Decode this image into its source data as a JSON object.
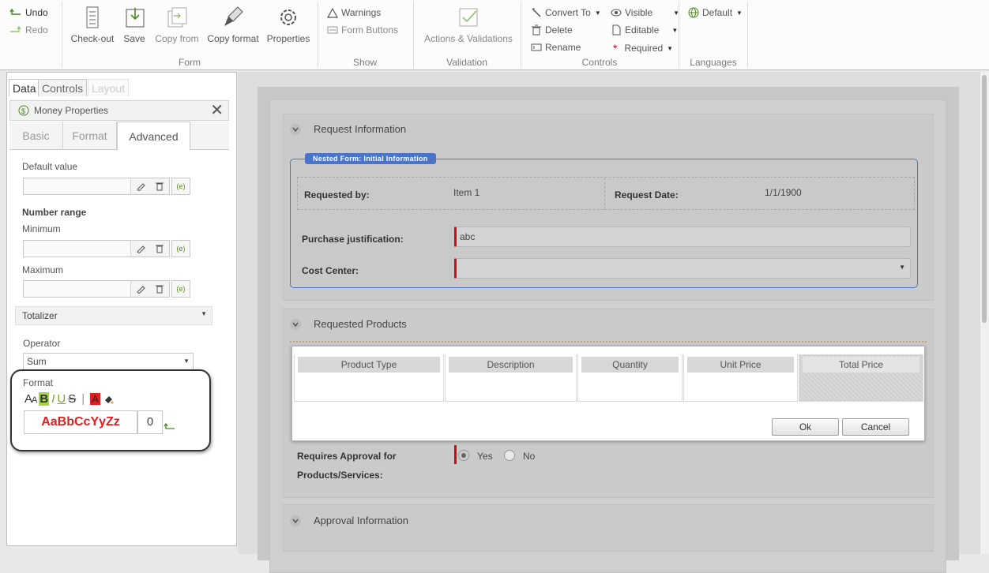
{
  "ribbon": {
    "undo": "Undo",
    "redo": "Redo",
    "form_group": {
      "label": "Form",
      "checkout": "Check-out",
      "save": "Save",
      "copy_from": "Copy from",
      "copy_format": "Copy format",
      "properties": "Properties"
    },
    "show_group": {
      "label": "Show",
      "warnings": "Warnings",
      "form_buttons": "Form Buttons"
    },
    "validation_group": {
      "label": "Validation",
      "actions": "Actions & Validations"
    },
    "controls_group": {
      "label": "Controls",
      "convert_to": "Convert To",
      "delete": "Delete",
      "rename": "Rename",
      "visible": "Visible",
      "editable": "Editable",
      "required": "Required"
    },
    "languages_group": {
      "label": "Languages",
      "default": "Default"
    }
  },
  "left_panel": {
    "tabs": [
      "Data",
      "Controls",
      "Layout"
    ],
    "header_title": "Money Properties",
    "sub_tabs": [
      "Basic",
      "Format",
      "Advanced"
    ],
    "default_value_label": "Default value",
    "number_range_label": "Number range",
    "minimum_label": "Minimum",
    "maximum_label": "Maximum",
    "expr_label": "(e)",
    "totalizer_label": "Totalizer",
    "operator_label": "Operator",
    "operator_value": "Sum",
    "format_label": "Format",
    "format_preview": "AaBbCcYyZz",
    "format_decimals": "0"
  },
  "form": {
    "section1_title": "Request Information",
    "nested_tag": "Nested Form: Initial Information",
    "requested_by_label": "Requested by:",
    "requested_by_value": "Item 1",
    "request_date_label": "Request Date:",
    "request_date_value": "1/1/1900",
    "purchase_label": "Purchase justification:",
    "purchase_value": "abc",
    "cost_center_label": "Cost Center:",
    "section2_title": "Requested Products",
    "columns": [
      "Product Type",
      "Description",
      "Quantity",
      "Unit Price",
      "Total Price"
    ],
    "ok_button": "Ok",
    "cancel_button": "Cancel",
    "requires_approval_label_1": "Requires Approval for",
    "requires_approval_label_2": "Products/Services:",
    "yes": "Yes",
    "no": "No",
    "section3_title": "Approval Information"
  },
  "colors": {
    "required_marker": "#c0101a",
    "nested_border": "#4a74c9",
    "format_preview_text": "#e02020"
  }
}
